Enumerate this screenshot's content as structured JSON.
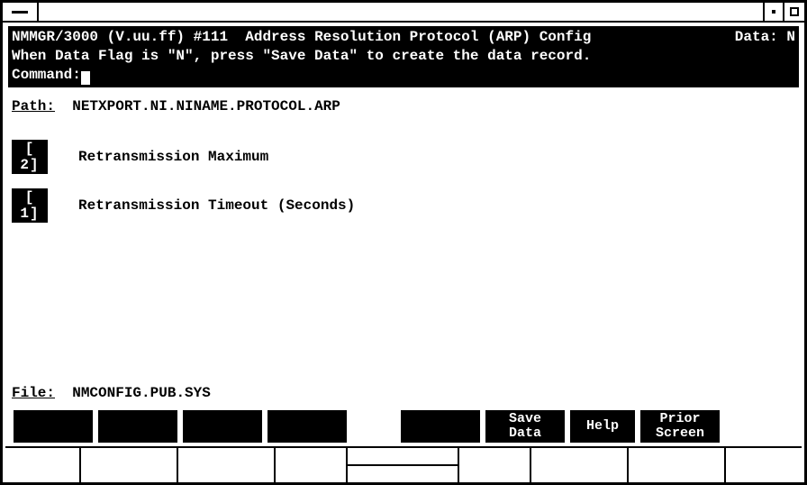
{
  "header": {
    "app": "NMMGR/3000 (V.uu.ff) #111",
    "screen_title": "Address Resolution Protocol (ARP) Config",
    "data_label": "Data:",
    "data_flag": "N",
    "hint": "When Data Flag is \"N\", press \"Save Data\" to create the data record.",
    "command_label": "Command:"
  },
  "path": {
    "label": "Path:",
    "value": "NETXPORT.NI.NINAME.PROTOCOL.ARP"
  },
  "fields": [
    {
      "value": "2",
      "display": "[ 2]",
      "label": "Retransmission Maximum"
    },
    {
      "value": "1",
      "display": "[ 1]",
      "label": "Retransmission Timeout (Seconds)"
    }
  ],
  "file": {
    "label": "File:",
    "value": "NMCONFIG.PUB.SYS"
  },
  "softkeys": [
    {
      "line1": "",
      "line2": ""
    },
    {
      "line1": "",
      "line2": ""
    },
    {
      "line1": "",
      "line2": ""
    },
    {
      "line1": "",
      "line2": ""
    },
    {
      "line1": "",
      "line2": ""
    },
    {
      "line1": "Save",
      "line2": "Data"
    },
    {
      "line1": "Help",
      "line2": ""
    },
    {
      "line1": "Prior",
      "line2": "Screen"
    }
  ]
}
